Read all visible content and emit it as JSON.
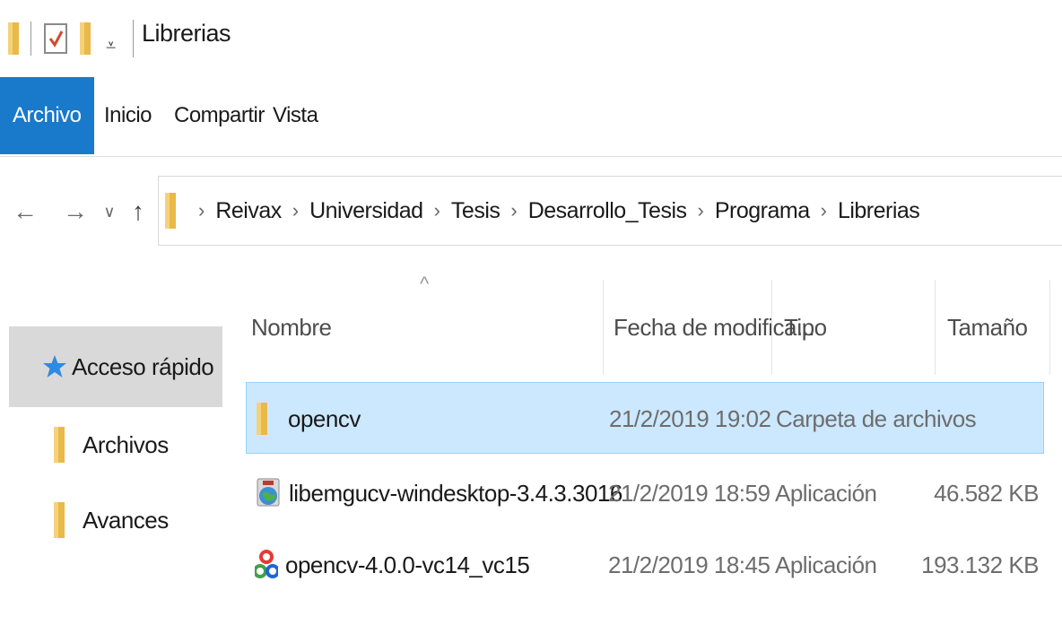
{
  "window": {
    "title": "Librerias"
  },
  "quick_access": {
    "folder_icon": "folder-icon",
    "properties_icon": "properties-checkmark-icon",
    "new_folder_icon": "new-folder-icon",
    "dropdown_glyph": "⩡"
  },
  "ribbon": {
    "tabs": [
      {
        "label": "Archivo",
        "active": true
      },
      {
        "label": "Inicio"
      },
      {
        "label": "Compartir"
      },
      {
        "label": "Vista"
      }
    ],
    "accent_color": "#1979ca"
  },
  "navigation": {
    "back_glyph": "←",
    "forward_glyph": "→",
    "recent_glyph": "∨",
    "up_glyph": "↑"
  },
  "address": {
    "breadcrumbs": [
      "Reivax",
      "Universidad",
      "Tesis",
      "Desarrollo_Tesis",
      "Programa",
      "Librerias"
    ],
    "separator": "›"
  },
  "nav_pane": {
    "quick_access_label": "Acceso rápido",
    "items": [
      {
        "label": "Archivos",
        "icon": "folder-icon"
      },
      {
        "label": "Avances",
        "icon": "folder-icon"
      }
    ]
  },
  "file_list": {
    "sort_glyph": "^",
    "columns": {
      "name": "Nombre",
      "date": "Fecha de modifica...",
      "type": "Tipo",
      "size": "Tamaño"
    },
    "rows": [
      {
        "name": "opencv",
        "date": "21/2/2019 19:02",
        "type": "Carpeta de archivos",
        "size": "",
        "icon": "folder-icon",
        "selected": true
      },
      {
        "name": "libemgucv-windesktop-3.4.3.3016",
        "date": "21/2/2019 18:59",
        "type": "Aplicación",
        "size": "46.582 KB",
        "icon": "installer-globe-icon"
      },
      {
        "name": "opencv-4.0.0-vc14_vc15",
        "date": "21/2/2019 18:45",
        "type": "Aplicación",
        "size": "193.132 KB",
        "icon": "opencv-logo-icon"
      }
    ]
  }
}
